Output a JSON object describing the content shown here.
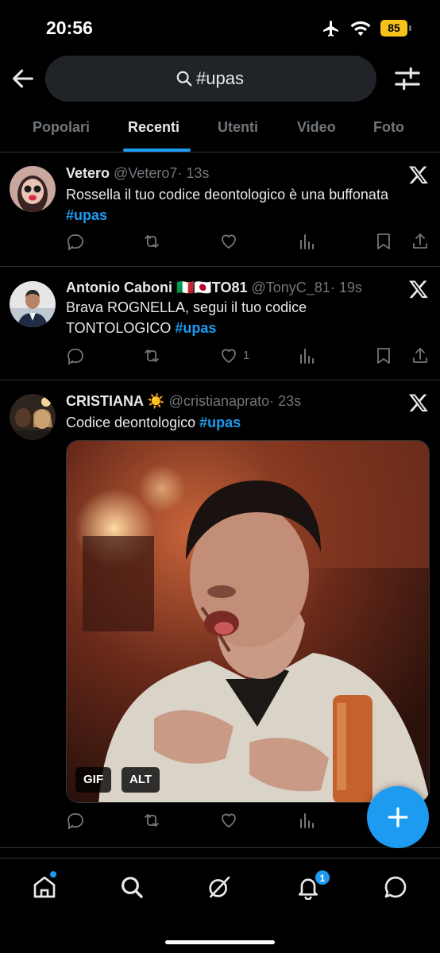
{
  "status_bar": {
    "time": "20:56",
    "battery": "85"
  },
  "search": {
    "query": "#upas"
  },
  "tabs": [
    {
      "label": "Popolari"
    },
    {
      "label": "Recenti"
    },
    {
      "label": "Utenti"
    },
    {
      "label": "Video"
    },
    {
      "label": "Foto"
    }
  ],
  "tweets": [
    {
      "name": "Vetero",
      "handle": "@Vetero7",
      "time": "· 13s",
      "text": "Rossella il tuo codice deontologico è una buffonata",
      "hashtag": "#upas",
      "likes": ""
    },
    {
      "name": "Antonio Caboni 🇮🇹🇯🇵TO81",
      "handle": "@TonyC_81",
      "time": "· 19s",
      "text": "Brava ROGNELLA,  segui il tuo codice TONTOLOGICO",
      "hashtag": "#upas",
      "likes": "1"
    },
    {
      "name": "CRISTIANA ☀️",
      "handle": "@cristianaprato",
      "time": "· 23s",
      "text": "Codice deontologico",
      "hashtag": "#upas",
      "likes": "",
      "media": {
        "gif_label": "GIF",
        "alt_label": "ALT"
      }
    }
  ],
  "bottom_nav": {
    "notifications_count": "1"
  },
  "colors": {
    "accent": "#1d9bf0",
    "background": "#000000",
    "muted": "#71767b",
    "text": "#e7e9ea"
  }
}
